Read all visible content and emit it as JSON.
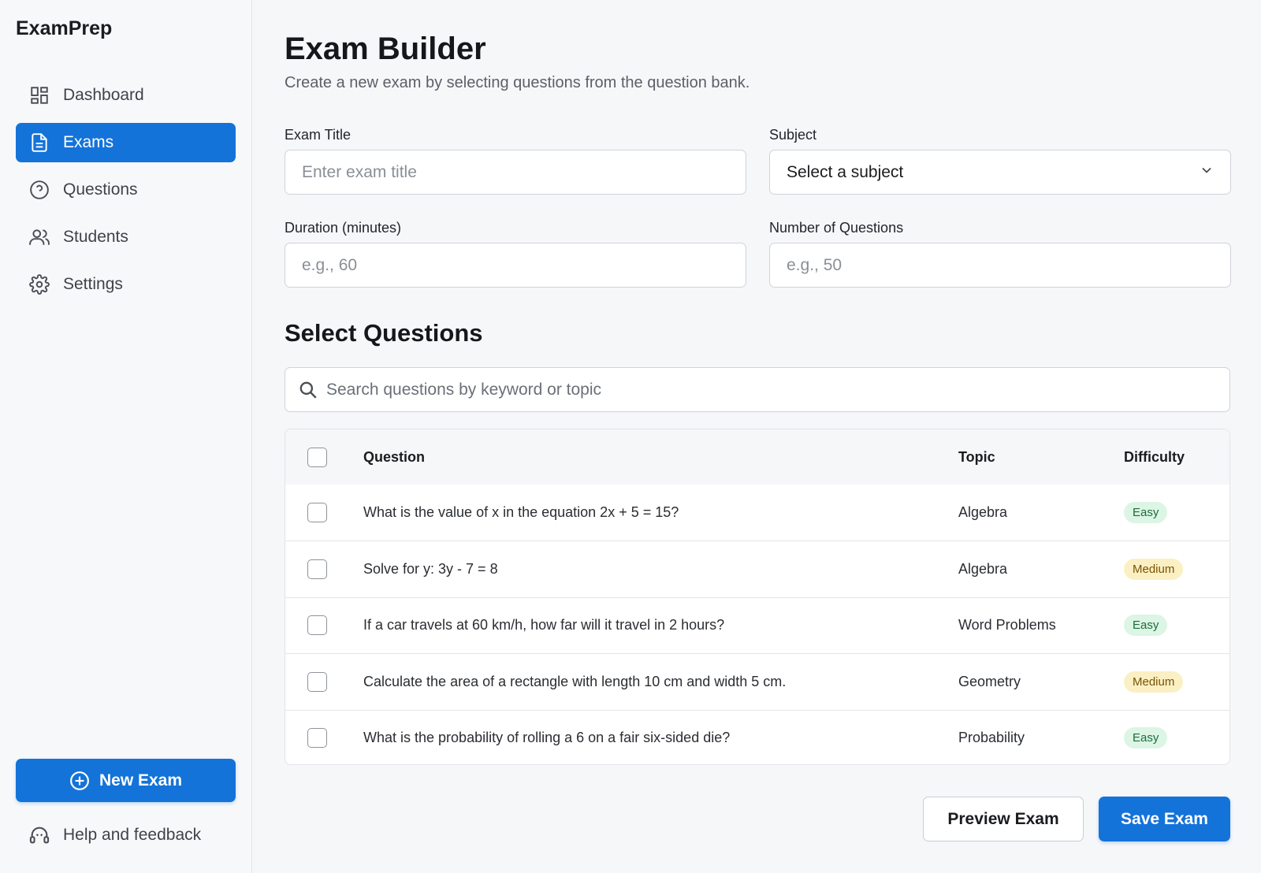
{
  "app": {
    "brand": "ExamPrep"
  },
  "sidebar": {
    "items": [
      {
        "label": "Dashboard",
        "icon": "dashboard-icon",
        "active": false
      },
      {
        "label": "Exams",
        "icon": "document-icon",
        "active": true
      },
      {
        "label": "Questions",
        "icon": "question-icon",
        "active": false
      },
      {
        "label": "Students",
        "icon": "users-icon",
        "active": false
      },
      {
        "label": "Settings",
        "icon": "gear-icon",
        "active": false
      }
    ],
    "new_exam_label": "New Exam",
    "help_label": "Help and feedback"
  },
  "page": {
    "title": "Exam Builder",
    "subtitle": "Create a new exam by selecting questions from the question bank."
  },
  "form": {
    "exam_title": {
      "label": "Exam Title",
      "placeholder": "Enter exam title",
      "value": ""
    },
    "subject": {
      "label": "Subject",
      "value": "Select a subject"
    },
    "duration": {
      "label": "Duration (minutes)",
      "placeholder": "e.g., 60",
      "value": ""
    },
    "num_questions": {
      "label": "Number of Questions",
      "placeholder": "e.g., 50",
      "value": ""
    }
  },
  "questions": {
    "section_title": "Select Questions",
    "search_placeholder": "Search questions by keyword or topic",
    "columns": {
      "question": "Question",
      "topic": "Topic",
      "difficulty": "Difficulty"
    },
    "rows": [
      {
        "question": "What is the value of x in the equation 2x + 5 = 15?",
        "topic": "Algebra",
        "difficulty": "Easy"
      },
      {
        "question": "Solve for y: 3y - 7 = 8",
        "topic": "Algebra",
        "difficulty": "Medium"
      },
      {
        "question": "If a car travels at 60 km/h, how far will it travel in 2 hours?",
        "topic": "Word Problems",
        "difficulty": "Easy"
      },
      {
        "question": "Calculate the area of a rectangle with length 10 cm and width 5 cm.",
        "topic": "Geometry",
        "difficulty": "Medium"
      },
      {
        "question": "What is the probability of rolling a 6 on a fair six-sided die?",
        "topic": "Probability",
        "difficulty": "Easy"
      }
    ]
  },
  "actions": {
    "preview_label": "Preview Exam",
    "save_label": "Save Exam"
  },
  "colors": {
    "accent": "#1473d9",
    "easy_bg": "#dcf5e5",
    "medium_bg": "#fbf0c4"
  }
}
